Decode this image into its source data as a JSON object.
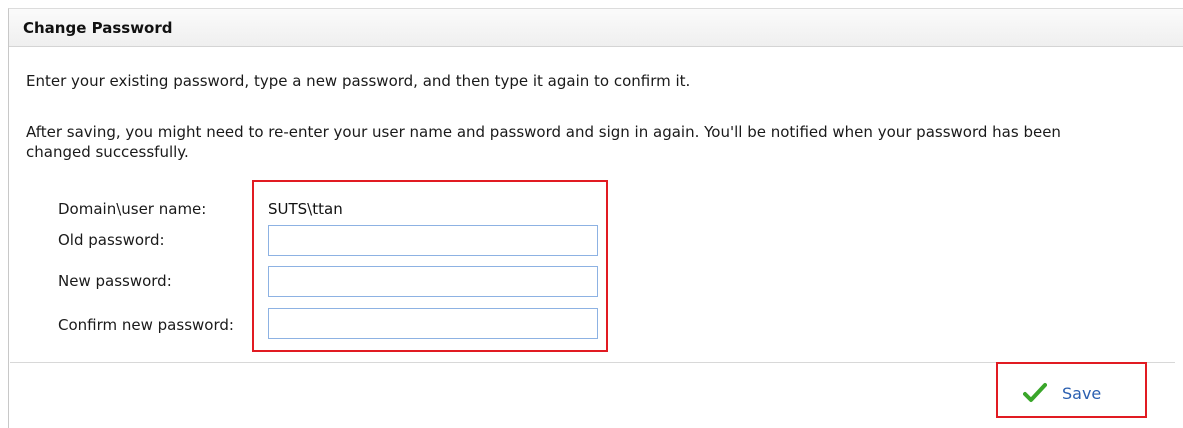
{
  "panel": {
    "title": "Change Password"
  },
  "instructions": {
    "intro": "Enter your existing password, type a new password, and then type it again to confirm it.",
    "note": "After saving, you might need to re-enter your user name and password and sign in again. You'll be notified when your password has been changed successfully."
  },
  "form": {
    "domain_label": "Domain\\user name:",
    "domain_value": "SUTS\\ttan",
    "old_label": "Old password:",
    "old_value": "",
    "new_label": "New password:",
    "new_value": "",
    "confirm_label": "Confirm new password:",
    "confirm_value": ""
  },
  "actions": {
    "save_label": "Save",
    "save_icon": "check-icon"
  },
  "colors": {
    "highlight": "#e11b22",
    "input_border": "#8db2e3",
    "link_blue": "#2a5fb0",
    "check_green": "#3aa62a"
  }
}
